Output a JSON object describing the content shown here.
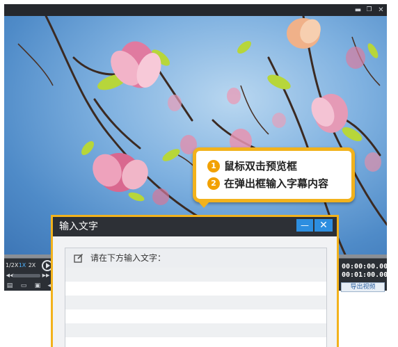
{
  "player": {
    "window_controls": {
      "minimize": "▬",
      "restore": "❐",
      "close": "✕"
    },
    "preview": {
      "description_icon": "magnolia-photo"
    },
    "speed_options": [
      "1/2X",
      "1X",
      "2X"
    ],
    "selected_speed": "1X",
    "timecode_current": "00:00:00.000",
    "timecode_total": "00:01:00.000",
    "export_label": "导出视频"
  },
  "callout": {
    "steps": [
      {
        "num": "1",
        "text": "鼠标双击预览框"
      },
      {
        "num": "2",
        "text": "在弹出框输入字幕内容"
      }
    ]
  },
  "dialog": {
    "title": "输入文字",
    "minimize_label": "—",
    "close_label": "✕",
    "prompt": "请在下方输入文字："
  },
  "colors": {
    "accent": "#f2b21c",
    "dialog_button": "#2d8ee0",
    "title_bar": "#2d3036"
  }
}
